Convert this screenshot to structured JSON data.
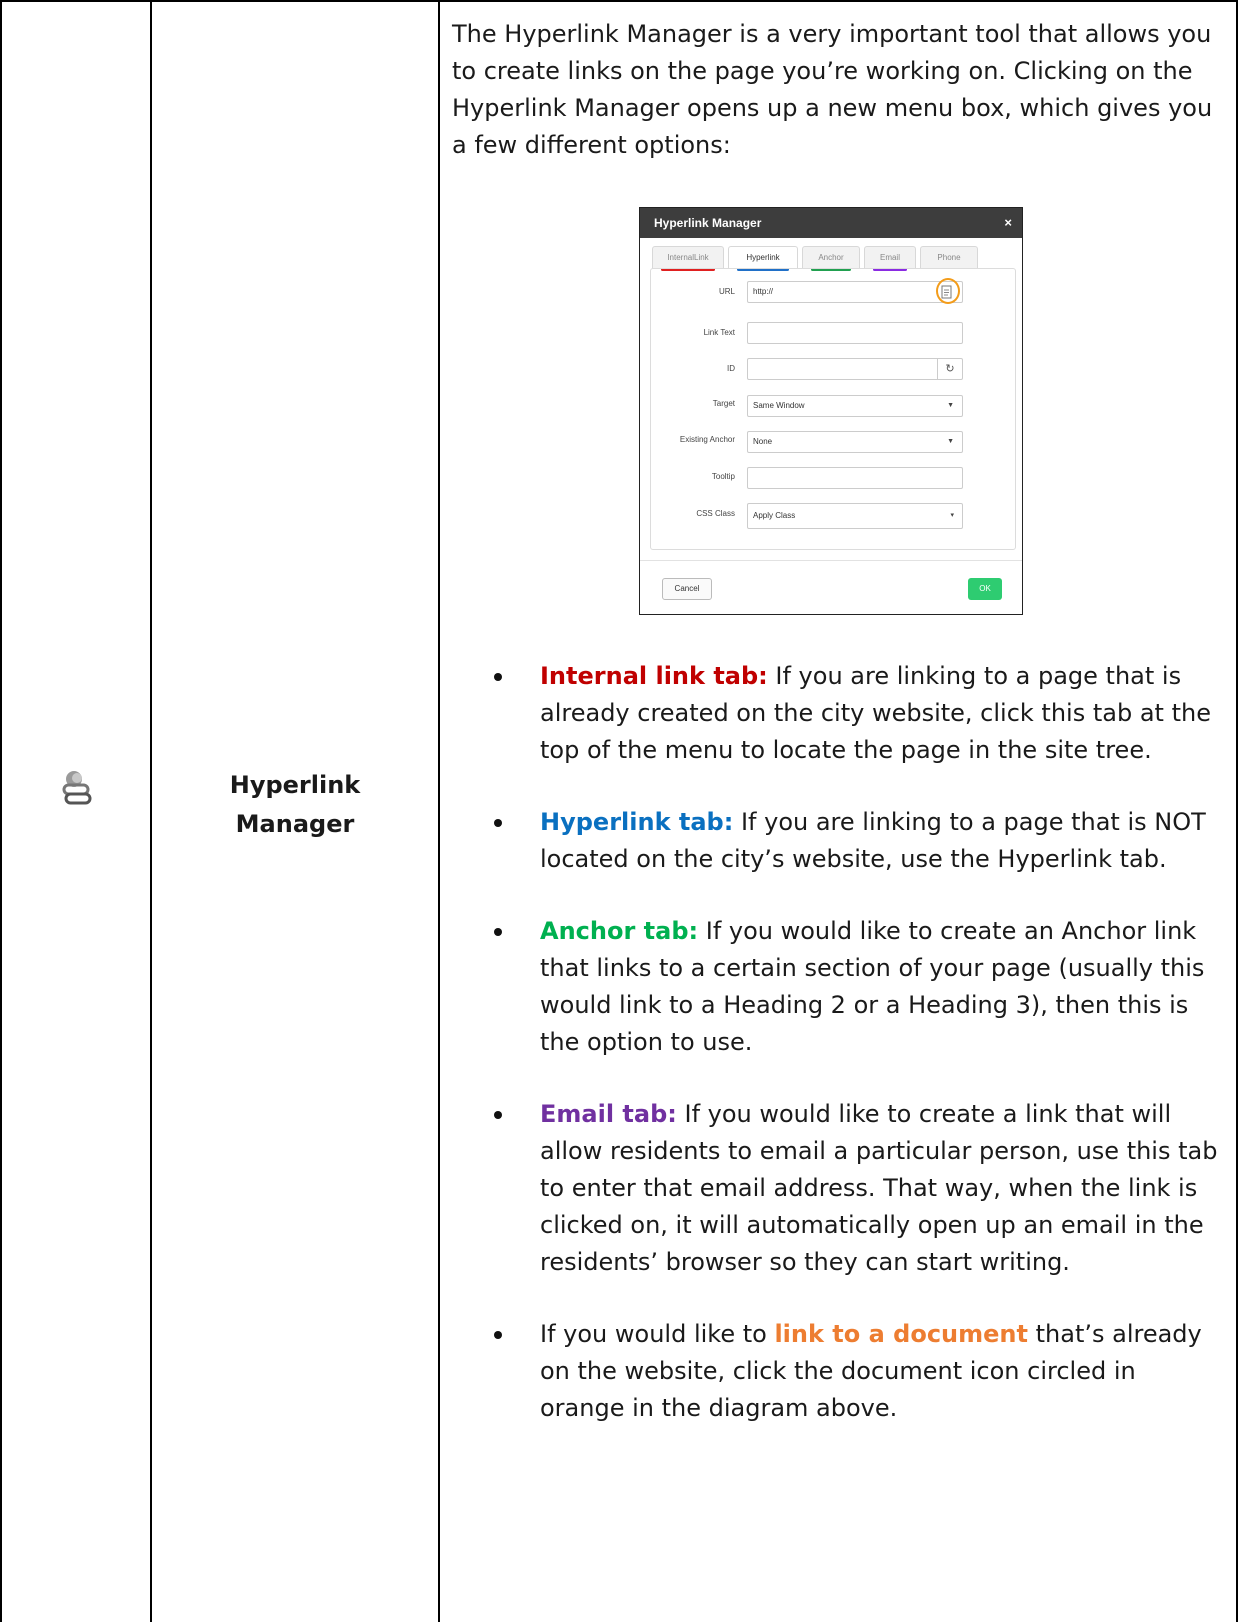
{
  "tool": {
    "name_line1": "Hyperlink",
    "name_line2": "Manager",
    "icon": "link-icon"
  },
  "intro": "The Hyperlink Manager is a very important tool that allows you to create links on the page you’re working on. Clicking on the Hyperlink Manager opens up a new menu box, which gives you a few different options:",
  "dialog": {
    "title": "Hyperlink Manager",
    "close": "×",
    "tabs": [
      {
        "label": "InternalLink",
        "underline": "#e02020"
      },
      {
        "label": "Hyperlink",
        "underline": "#2070c8"
      },
      {
        "label": "Anchor",
        "underline": "#21a050"
      },
      {
        "label": "Email",
        "underline": "#8a2be2"
      },
      {
        "label": "Phone",
        "underline": ""
      }
    ],
    "fields": {
      "url_label": "URL",
      "url_value": "http://",
      "linktext_label": "Link Text",
      "id_label": "ID",
      "target_label": "Target",
      "target_value": "Same Window",
      "anchor_label": "Existing Anchor",
      "anchor_value": "None",
      "tooltip_label": "Tooltip",
      "css_label": "CSS Class",
      "css_value": "Apply Class"
    },
    "cancel": "Cancel",
    "ok": "OK",
    "circle_color": "#f39c1a"
  },
  "bullets": [
    {
      "lead": "Internal link tab:",
      "color": "#c00000",
      "text": " If you are linking to a page that is already created on the city website, click this tab at the top of the menu to locate the page in the site tree."
    },
    {
      "lead": "Hyperlink tab:",
      "color": "#0a70c0",
      "text": " If you are linking to a page that is NOT located on the city’s website, use the Hyperlink tab."
    },
    {
      "lead": "Anchor tab:",
      "color": "#00b050",
      "text": " If you would like to create an Anchor link that links to a certain section of your page (usually this would link to a Heading 2 or a Heading 3), then this is the option to use."
    },
    {
      "lead": "Email tab:",
      "color": "#7030a0",
      "text": " If you would like to create a link that will allow residents to email a particular person, use this tab to enter that email address. That way, when the link is clicked on, it will automatically open up an email in the residents’ browser so they can start writing."
    }
  ],
  "last_bullet": {
    "before": "If you would like to ",
    "lead": "link to a document",
    "color": "#ed7d31",
    "after": " that’s already on the website, click the document icon circled in orange in the diagram above."
  }
}
